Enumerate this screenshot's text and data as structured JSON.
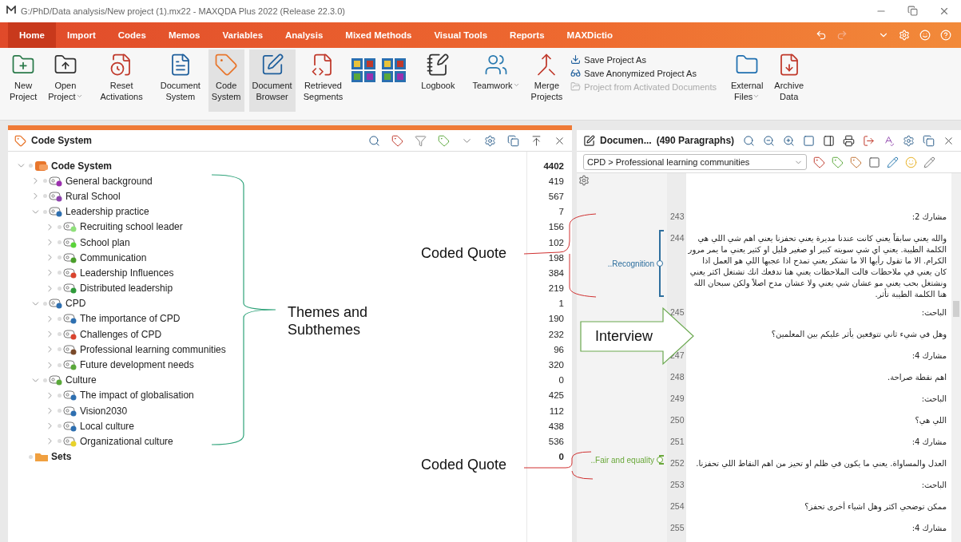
{
  "window": {
    "title": "G:/PhD/Data analysis/New project (1).mx22 - MAXQDA Plus 2022 (Release 22.3.0)"
  },
  "menu_tabs": [
    {
      "label": "Home",
      "selected": true
    },
    {
      "label": "Import",
      "selected": false
    },
    {
      "label": "Codes",
      "selected": false
    },
    {
      "label": "Memos",
      "selected": false
    },
    {
      "label": "Variables",
      "selected": false
    },
    {
      "label": "Analysis",
      "selected": false
    },
    {
      "label": "Mixed Methods",
      "selected": false
    },
    {
      "label": "Visual Tools",
      "selected": false
    },
    {
      "label": "Reports",
      "selected": false
    },
    {
      "label": "MAXDictio",
      "selected": false
    }
  ],
  "ribbon": [
    {
      "items": [
        {
          "kind": "large",
          "lines": [
            "New",
            "Project"
          ],
          "active": false
        },
        {
          "kind": "large",
          "lines": [
            "Open",
            "Project"
          ],
          "active": false,
          "dropdown": true
        }
      ]
    },
    {
      "items": [
        {
          "kind": "large",
          "lines": [
            "Reset",
            "Activations"
          ],
          "active": false
        }
      ]
    },
    {
      "items": [
        {
          "kind": "large",
          "lines": [
            "Document",
            "System"
          ],
          "active": false
        },
        {
          "kind": "large",
          "lines": [
            "Code",
            "System"
          ],
          "active": true
        },
        {
          "kind": "large",
          "lines": [
            "Document",
            "Browser"
          ],
          "active": true
        },
        {
          "kind": "large",
          "lines": [
            "Retrieved",
            "Segments"
          ],
          "active": false
        },
        {
          "kind": "tiles"
        },
        {
          "kind": "tiles"
        }
      ]
    },
    {
      "items": [
        {
          "kind": "large",
          "lines": [
            "Logbook"
          ],
          "active": false
        }
      ]
    },
    {
      "items": [
        {
          "kind": "large",
          "lines": [
            "Teamwork"
          ],
          "active": false,
          "dropdown": true
        },
        {
          "kind": "large",
          "lines": [
            "Merge",
            "Projects"
          ],
          "active": false
        },
        {
          "kind": "small",
          "label": "Save Project As",
          "disabled": false
        },
        {
          "kind": "small",
          "label": "Save Anonymized Project As",
          "disabled": false
        },
        {
          "kind": "small",
          "label": "Project from Activated Documents",
          "disabled": true
        }
      ]
    },
    {
      "items": [
        {
          "kind": "large",
          "lines": [
            "External",
            "Files"
          ],
          "active": false,
          "dropdown": true
        },
        {
          "kind": "large",
          "lines": [
            "Archive",
            "Data"
          ],
          "active": false
        }
      ]
    }
  ],
  "code_panel": {
    "title": "Code System",
    "tree": [
      {
        "label": "Code System",
        "count": "4402",
        "kind": "root",
        "expanded": true,
        "children": [
          {
            "label": "General background",
            "count": "419",
            "kind": "code",
            "color": "#9b2fae",
            "expanded": false
          },
          {
            "label": "Rural School",
            "count": "567",
            "kind": "code",
            "color": "#8e44ad",
            "expanded": false
          },
          {
            "label": "Leadership practice",
            "count": "7",
            "kind": "code",
            "color": "#2e6fb0",
            "expanded": true,
            "children": [
              {
                "label": "Recruiting school leader",
                "count": "156",
                "kind": "code",
                "color": "#8fe07a",
                "expanded": false
              },
              {
                "label": "School plan",
                "count": "102",
                "kind": "code",
                "color": "#5ad33a",
                "expanded": false
              },
              {
                "label": "Communication",
                "count": "198",
                "kind": "code",
                "color": "#4a9e2a",
                "expanded": false
              },
              {
                "label": "Leadership Influences",
                "count": "384",
                "kind": "code",
                "color": "#d9442e",
                "expanded": false
              },
              {
                "label": "Distributed leadership",
                "count": "219",
                "kind": "code",
                "color": "#2f9a3a",
                "expanded": false
              }
            ]
          },
          {
            "label": "CPD",
            "count": "1",
            "kind": "code",
            "color": "#2e6fb0",
            "expanded": true,
            "children": [
              {
                "label": "The importance of CPD",
                "count": "190",
                "kind": "code",
                "color": "#2e6fb0",
                "expanded": false
              },
              {
                "label": "Challenges of CPD",
                "count": "232",
                "kind": "code",
                "color": "#d9442e",
                "expanded": false
              },
              {
                "label": "Professional learning communities",
                "count": "96",
                "kind": "code",
                "color": "#7a4a2a",
                "expanded": false
              },
              {
                "label": "Future development needs",
                "count": "320",
                "kind": "code",
                "color": "#5aa83a",
                "expanded": false
              }
            ]
          },
          {
            "label": "Culture",
            "count": "0",
            "kind": "code",
            "color": "#5aa83a",
            "expanded": true,
            "children": [
              {
                "label": "The impact of globalisation",
                "count": "425",
                "kind": "code",
                "color": "#2e6fb0",
                "expanded": false
              },
              {
                "label": "Vision2030",
                "count": "112",
                "kind": "code",
                "color": "#2e6fb0",
                "expanded": false
              },
              {
                "label": "Local culture",
                "count": "438",
                "kind": "code",
                "color": "#2e6fb0",
                "expanded": false
              },
              {
                "label": "Organizational culture",
                "count": "536",
                "kind": "code",
                "color": "#e8d22a",
                "expanded": false
              }
            ]
          }
        ]
      },
      {
        "label": "Sets",
        "count": "0",
        "kind": "sets"
      }
    ]
  },
  "document_panel": {
    "title": "Documen...",
    "paragraph_count": "(490 Paragraphs)",
    "breadcrumb": "CPD > Professional learning communities",
    "paragraphs": [
      {
        "number": "243",
        "text": "مشارك 2:"
      },
      {
        "number": "244",
        "text": "والله يعني سابقاً يعني كانت عندنا مديرة يعني تحفزنا يعني اهم شي اللي هي الكلمة الطيبة. يعني اي شي سويته كبير او صغير قليل او كثير يعني ما يمر مرور الكرام. الا ما تقول رأيها الا ما تشكر يعني تمدح اذا عجبها اللي هو العمل اذا كان يعني في ملاحظات قالت الملاحظات يعني هنا تدفعك انك تشتغل اكثر يعني ونشتغل بحب يعني مو عشان شي يعني ولا عشان مدح اصلاً ولكن سبحان الله هنا الكلمة الطيبة تأثر.",
        "code": {
          "label": "..Recognition",
          "color": "#2e6f9e"
        }
      },
      {
        "number": "245",
        "text": "الباحث:"
      },
      {
        "text": "وهل في شيء ثاني تتوقعين يأثر عليكم بين المعلمين؟"
      },
      {
        "number": "247",
        "text": "مشارك 4:"
      },
      {
        "number": "248",
        "text": "اهم نقطة صراحة."
      },
      {
        "number": "249",
        "text": "الباحث:"
      },
      {
        "number": "250",
        "text": "اللي هي؟"
      },
      {
        "number": "251",
        "text": "مشارك 4:"
      },
      {
        "number": "252",
        "text": "العدل والمساواة. يعني ما يكون في ظلم او تحيز من اهم النقاط اللي تحفزنا.",
        "code": {
          "label": "..Fair and equality",
          "color": "#6aa83a"
        }
      },
      {
        "number": "253",
        "text": "الباحث:"
      },
      {
        "number": "254",
        "text": "ممكن توضحي اكثر وهل اشياء أخرى تحفز؟"
      },
      {
        "number": "255",
        "text": "مشارك 4:"
      }
    ]
  },
  "annotations": [
    {
      "kind": "brace",
      "label": "Themes and Subthemes"
    },
    {
      "kind": "quote",
      "label": "Coded Quote"
    },
    {
      "kind": "quote",
      "label": "Coded Quote"
    },
    {
      "kind": "arrow",
      "label": "Interview"
    }
  ]
}
